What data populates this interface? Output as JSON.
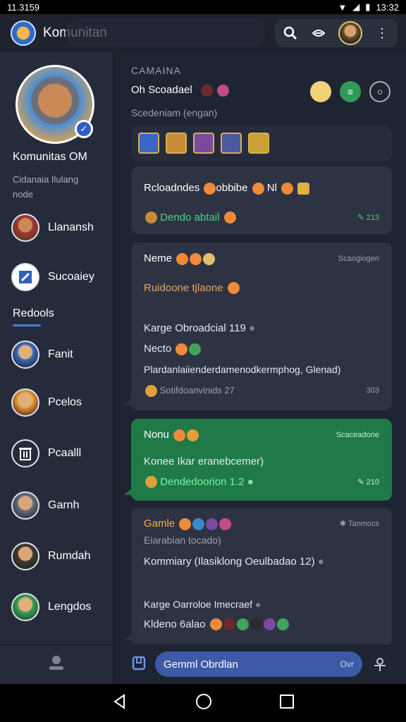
{
  "status": {
    "time": "11.3159",
    "right_time": "13:32"
  },
  "app": {
    "title": "Komunitan"
  },
  "sidebar": {
    "profile_name": "Komunitas OM",
    "profile_desc": "Cidanaia  Ilulang node",
    "section_label": "Redools",
    "items": [
      {
        "label": "Llanansh",
        "icon": "avatar-icon"
      },
      {
        "label": "Sucoaiey",
        "icon": "shield-icon"
      },
      {
        "label": "Fanit",
        "icon": "avatar-icon"
      },
      {
        "label": "Pcelos",
        "icon": "avatar-icon"
      },
      {
        "label": "Pcaalll",
        "icon": "trash-icon"
      },
      {
        "label": "Garnh",
        "icon": "avatar-icon"
      },
      {
        "label": "Rumdah",
        "icon": "avatar-icon"
      },
      {
        "label": "Lengdos",
        "icon": "avatar-icon"
      }
    ]
  },
  "main": {
    "header_label": "CAMAINA",
    "header_title": "Oh Scoadael",
    "header_sub": "Scedeniam (engan)",
    "messages": [
      {
        "name": "Rcloadndes",
        "name_suffix": "obbibe",
        "name_tag": "Nl",
        "link": "Dendo abtail",
        "meta": "213"
      },
      {
        "name": "Neme",
        "meta": "Scaogiogen",
        "orange": "Ruidoone tjlaone",
        "line1": "Karge Obroadcial 119",
        "line2": "Necto",
        "line3": "Plardanlaiienderdamenodkermphog, Glenad)",
        "small": "Sotifdoanvinids 27",
        "time": "303"
      },
      {
        "name": "Nonu",
        "meta": "Scaceadone",
        "line1": "Konee Ikar eranebcemer)",
        "link": "Dendedoorion 1.2",
        "time": "210"
      },
      {
        "name": "Gamle",
        "meta": "Tanmocs",
        "line0": "Eiarabian tocado)",
        "line1": "Kommiary (Ilasiklong Oeulbadao 12)",
        "line2": "Karge Oarroloe Imecraef",
        "line3": "Kldeno 6alao"
      }
    ],
    "composer_placeholder": "Gemml Obrdlan",
    "composer_hint": "Ovr"
  }
}
